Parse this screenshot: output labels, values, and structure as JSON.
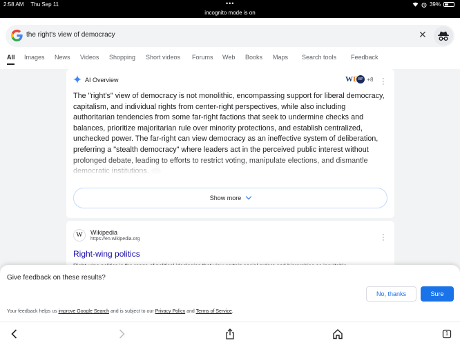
{
  "status_bar": {
    "time": "2:58 AM",
    "date": "Thu Sep 11",
    "battery": "39%",
    "battery_level": 0.39
  },
  "incognito_banner": "incognito mode is on",
  "search": {
    "query": "the right's view of democracy"
  },
  "tabs": [
    "All",
    "Images",
    "News",
    "Videos",
    "Shopping",
    "Short videos",
    "Forums",
    "Web",
    "Books",
    "Maps",
    "Search tools",
    "Feedback"
  ],
  "ai_overview": {
    "title": "AI Overview",
    "sources_more": "+8",
    "text": "The \"right's\" view of democracy is not monolithic, encompassing support for liberal democracy, capitalism, and individual rights from center-right perspectives, while also including authoritarian tendencies from some far-right factions that seek to undermine checks and balances, prioritize majoritarian rule over minority protections, and establish centralized, unchecked power. The far-right can view democracy as an ineffective system of deliberation, preferring a \"stealth democracy\" where leaders act in the perceived public interest without prolonged debate, leading to efforts to restrict voting, manipulate elections, and dismantle democratic institutions.",
    "show_more": "Show more"
  },
  "result": {
    "site": "Wikipedia",
    "url": "https://en.wikipedia.org",
    "title": "Right-wing politics",
    "snippet": "Right-wing politics is the range of political ideologies that view certain social orders and hierarchies as inevitable"
  },
  "feedback": {
    "question": "Give feedback on these results?",
    "no_thanks": "No, thanks",
    "sure": "Sure",
    "note_prefix": "Your feedback helps us ",
    "note_link1": "improve Google Search",
    "note_mid": " and is subject to our ",
    "note_link2": "Privacy Policy",
    "note_and": " and ",
    "note_link3": "Terms of Service",
    "note_end": "."
  },
  "toolbar": {
    "tab_count": "1"
  },
  "colors": {
    "link": "#1a0dab",
    "accent": "#1a73e8",
    "background": "#f1f3f4"
  },
  "icons": [
    "google-logo-icon",
    "clear-icon",
    "incognito-icon",
    "sparkle-icon",
    "more-vert-icon",
    "back-icon",
    "forward-icon",
    "share-icon",
    "home-icon",
    "tabs-icon"
  ]
}
